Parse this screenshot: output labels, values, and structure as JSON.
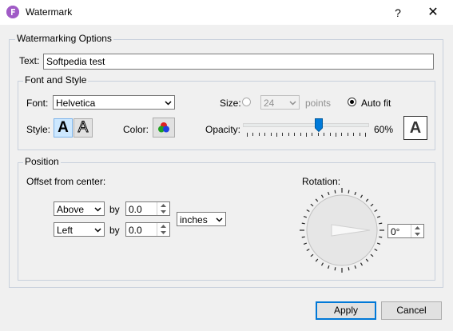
{
  "window": {
    "title": "Watermark",
    "help_glyph": "?",
    "close_glyph": "✕"
  },
  "watermarking_options": {
    "group_label": "Watermarking Options",
    "text_label": "Text:",
    "text_value": "Softpedia test"
  },
  "font_style": {
    "group_label": "Font and Style",
    "font_label": "Font:",
    "font_value": "Helvetica",
    "size_label": "Size:",
    "size_value": "24",
    "points_label": "points",
    "auto_fit_label": "Auto fit",
    "size_mode": "auto-fit",
    "style_label": "Style:",
    "style_filled_glyph": "A",
    "style_outline_glyph": "A",
    "color_label": "Color:",
    "color_icon": "rgb-circles-icon",
    "opacity_label": "Opacity:",
    "opacity_value": "60%",
    "opacity_fraction": 0.6,
    "preview_glyph": "A"
  },
  "position": {
    "group_label": "Position",
    "offset_label": "Offset from center:",
    "vertical_value": "Above",
    "by_label_1": "by",
    "vertical_offset": "0.0",
    "horizontal_value": "Left",
    "by_label_2": "by",
    "horizontal_offset": "0.0",
    "units_value": "inches",
    "rotation_label": "Rotation:",
    "rotation_value": "0°"
  },
  "buttons": {
    "apply": "Apply",
    "cancel": "Cancel"
  },
  "colors": {
    "accent": "#a05bc6",
    "window_bg": "#f0f0f0",
    "group_border": "#c8d0dc"
  }
}
